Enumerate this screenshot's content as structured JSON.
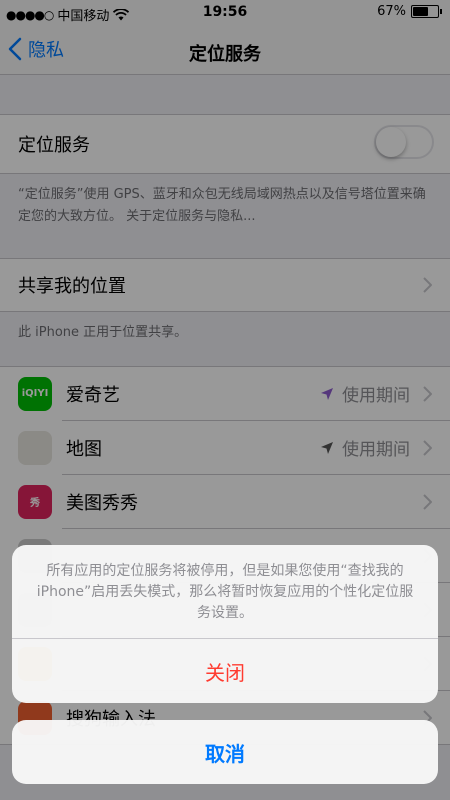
{
  "status_bar": {
    "signal_dots": "●●●●○",
    "carrier": "中国移动",
    "time": "19:56",
    "battery_percent": "67%",
    "battery_level": 0.67
  },
  "nav": {
    "back_label": "隐私",
    "title": "定位服务"
  },
  "location_services": {
    "label": "定位服务",
    "enabled": false,
    "footer": "“定位服务”使用 GPS、蓝牙和众包无线局域网热点以及信号塔位置来确定您的大致方位。 关于定位服务与隐私..."
  },
  "share_location": {
    "label": "共享我的位置",
    "footer": "此 iPhone 正用于位置共享。"
  },
  "apps": [
    {
      "name": "爱奇艺",
      "icon": "iqiyi-icon",
      "icon_text": "iQIYI",
      "color": "#00be06",
      "status": "使用期间",
      "arrow_color": "#8e5ccf"
    },
    {
      "name": "地图",
      "icon": "maps-icon",
      "icon_text": "",
      "color": "#e8e6df",
      "status": "使用期间",
      "arrow_color": "#555555"
    },
    {
      "name": "美图秀秀",
      "icon": "meitu-icon",
      "icon_text": "秀",
      "color": "#e0245e",
      "status": "",
      "arrow_color": ""
    },
    {
      "name": "",
      "icon": "app-icon",
      "icon_text": "",
      "color": "#cccccc",
      "status": "",
      "arrow_color": ""
    },
    {
      "name": "",
      "icon": "app-icon",
      "icon_text": "",
      "color": "#cccccc",
      "status": "",
      "arrow_color": ""
    },
    {
      "name": "",
      "icon": "app-icon",
      "icon_text": "",
      "color": "#f0a020",
      "status": "",
      "arrow_color": ""
    },
    {
      "name": "搜狗输入法",
      "icon": "sogou-icon",
      "icon_text": "",
      "color": "#f06030",
      "status": "",
      "arrow_color": ""
    }
  ],
  "action_sheet": {
    "message": "所有应用的定位服务将被停用，但是如果您使用“查找我的 iPhone”启用丢失模式，那么将暂时恢复应用的个性化定位服务设置。",
    "close_label": "关闭",
    "cancel_label": "取消"
  },
  "colors": {
    "accent": "#007aff",
    "destructive": "#ff3b30"
  }
}
